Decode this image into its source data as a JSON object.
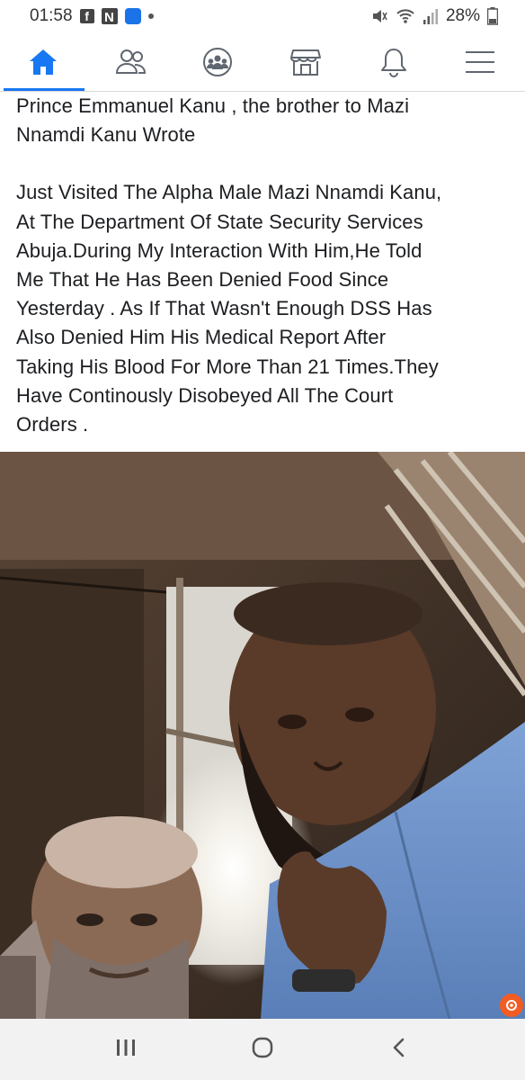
{
  "status_bar": {
    "time": "01:58",
    "battery_percent": "28%",
    "notification_icons": [
      "facebook-icon",
      "nairaland-icon",
      "app-icon",
      "dot-icon"
    ],
    "system_icons": [
      "mute-icon",
      "wifi-icon",
      "signal-icon",
      "battery-icon"
    ]
  },
  "nav": {
    "items": [
      {
        "name": "home",
        "icon": "home-icon",
        "active": true
      },
      {
        "name": "friends",
        "icon": "friends-icon",
        "active": false
      },
      {
        "name": "groups",
        "icon": "groups-icon",
        "active": false
      },
      {
        "name": "marketplace",
        "icon": "marketplace-icon",
        "active": false
      },
      {
        "name": "notifications",
        "icon": "bell-icon",
        "active": false
      },
      {
        "name": "menu",
        "icon": "hamburger-menu-icon",
        "active": false
      }
    ],
    "accent_color": "#1877f2"
  },
  "post": {
    "lines_1": [
      "Prince Emmanuel Kanu , the brother to Mazi",
      "Nnamdi Kanu Wrote"
    ],
    "lines_2": [
      "Just Visited The Alpha Male Mazi Nnamdi Kanu,",
      "At The Department Of State Security Services",
      "Abuja.During My Interaction With Him,He Told",
      "Me That He Has Been Denied  Food  Since",
      "Yesterday . As If That Wasn't Enough DSS Has",
      "Also Denied Him His  Medical Report After",
      "Taking His Blood For More Than 21 Times.They",
      "Have Continously Disobeyed All The Court",
      "Orders ."
    ]
  },
  "photo": {
    "description_icon": "photo-image",
    "badge_icon": "badge-icon"
  },
  "android_nav": {
    "buttons": [
      "recent-apps-icon",
      "home-circle-icon",
      "back-icon"
    ]
  }
}
